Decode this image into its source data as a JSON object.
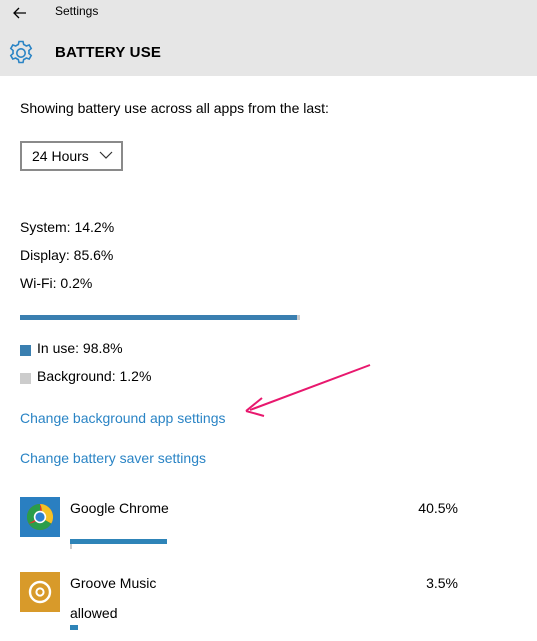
{
  "window": {
    "title": "Settings"
  },
  "header": {
    "page_title": "BATTERY USE"
  },
  "intro": "Showing battery use across all apps from the last:",
  "period_select": {
    "value": "24 Hours"
  },
  "breakdown": {
    "system": "System: 14.2%",
    "display": "Display: 85.6%",
    "wifi": "Wi-Fi: 0.2%"
  },
  "usage_bar": {
    "in_use_fraction": 0.988
  },
  "legend": {
    "in_use": "In use: 98.8%",
    "background": "Background: 1.2%"
  },
  "links": {
    "background_app": "Change background app settings",
    "battery_saver": "Change battery saver settings"
  },
  "apps": [
    {
      "name": "Google Chrome",
      "percent": "40.5%",
      "icon": "chrome-icon",
      "bar_fraction": 0.405
    },
    {
      "name": "Groove Music",
      "percent": "3.5%",
      "status": "allowed",
      "icon": "groove-music-icon",
      "bar_fraction": 0.035
    }
  ],
  "colors": {
    "accent": "#2a84c5",
    "bar_fill": "#3a7fb0",
    "bar_bg": "#cccccc",
    "annotation_arrow": "#e8186e",
    "titlebar_bg": "#e6e6e6",
    "groove_bg": "#d89a2a",
    "chrome_tile_bg": "#2a7fc1"
  }
}
